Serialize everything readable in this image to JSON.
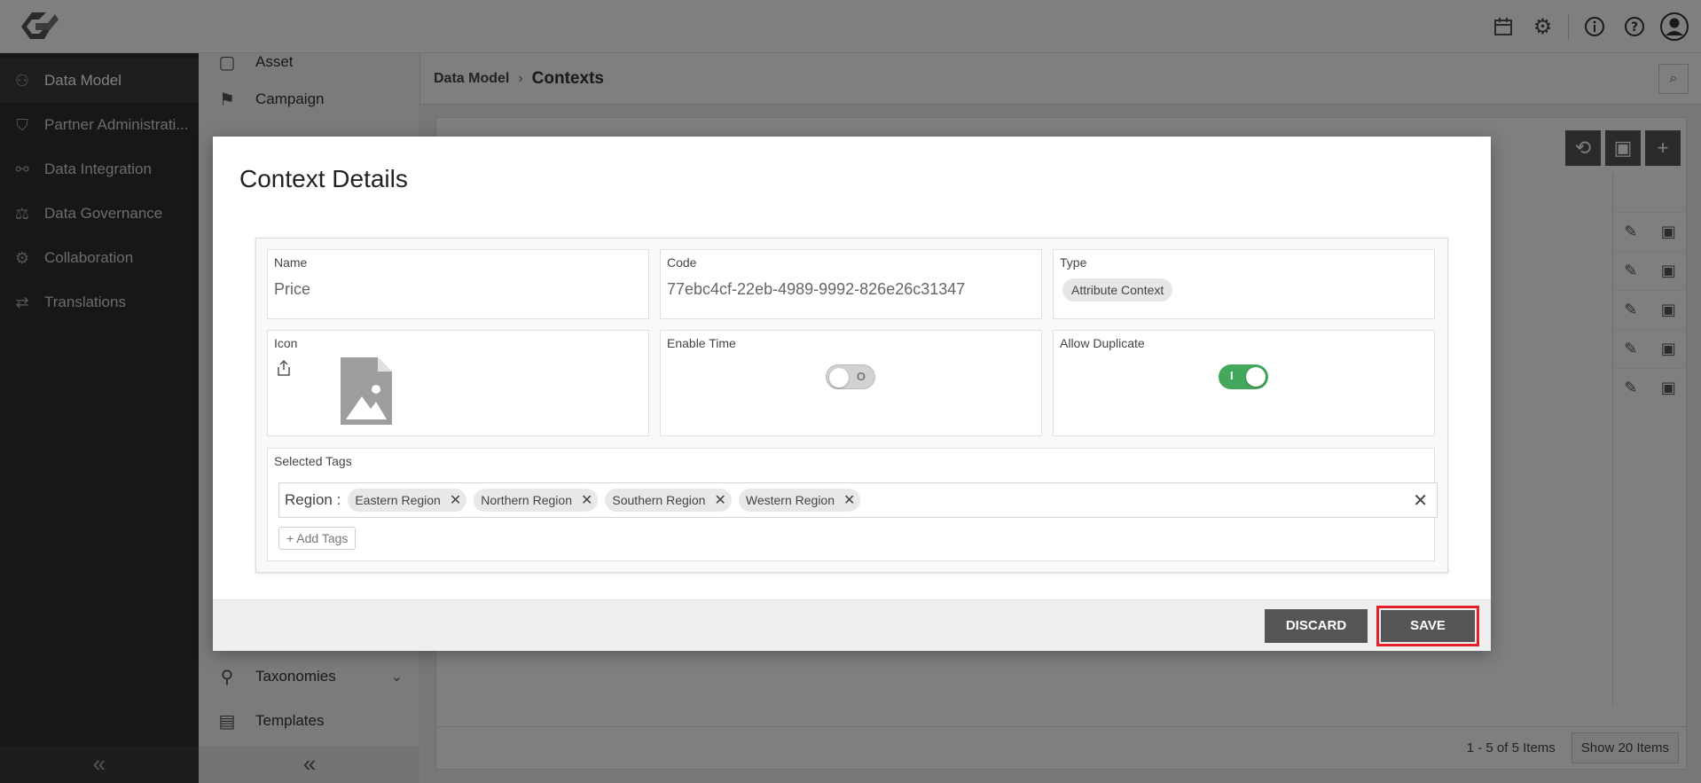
{
  "nav": {
    "items": [
      {
        "label": "Data Model",
        "icon": "data-model-icon"
      },
      {
        "label": "Partner Administrati...",
        "icon": "shield-icon"
      },
      {
        "label": "Data Integration",
        "icon": "integration-icon"
      },
      {
        "label": "Data Governance",
        "icon": "governance-icon"
      },
      {
        "label": "Collaboration",
        "icon": "collaboration-icon"
      },
      {
        "label": "Translations",
        "icon": "translations-icon"
      }
    ],
    "collapse": "«"
  },
  "subnav": {
    "items": [
      {
        "label": "Asset"
      },
      {
        "label": "Campaign"
      },
      {
        "label": "Taxonomies"
      },
      {
        "label": "Templates"
      }
    ],
    "collapse": "«"
  },
  "breadcrumb": {
    "root": "Data Model",
    "separator": "›",
    "current": "Contexts"
  },
  "grid": {
    "footer_info": "1 - 5 of 5 Items",
    "show_button": "Show 20 Items"
  },
  "modal": {
    "title": "Context Details",
    "fields": {
      "name_label": "Name",
      "name_value": "Price",
      "code_label": "Code",
      "code_value": "77ebc4cf-22eb-4989-9992-826e26c31347",
      "type_label": "Type",
      "type_value": "Attribute Context",
      "icon_label": "Icon",
      "enable_time_label": "Enable Time",
      "enable_time_state": "O",
      "allow_duplicate_label": "Allow Duplicate",
      "allow_duplicate_state": "I"
    },
    "tags": {
      "label": "Selected Tags",
      "group": "Region :",
      "items": [
        "Eastern Region",
        "Northern Region",
        "Southern Region",
        "Western Region"
      ],
      "add_label": "+ Add Tags"
    },
    "footer": {
      "discard": "DISCARD",
      "save": "SAVE"
    }
  },
  "colors": {
    "sidebar": "#2f2f2f",
    "button": "#555555",
    "toggle_on": "#43a85c",
    "save_highlight": "#e4202a"
  }
}
